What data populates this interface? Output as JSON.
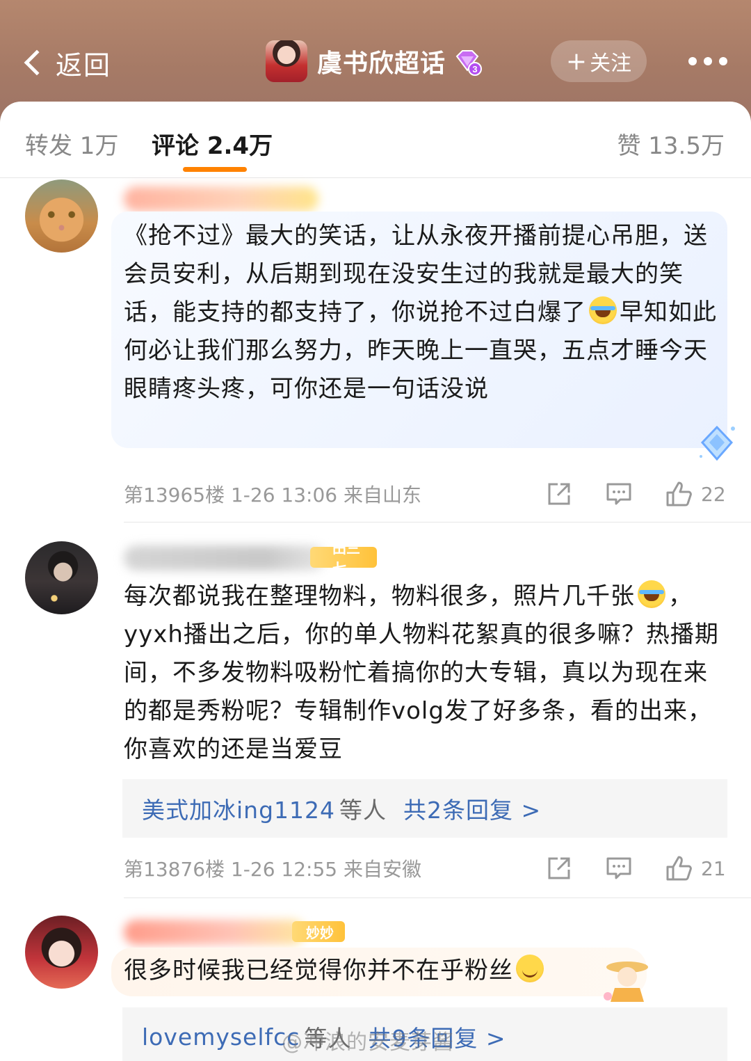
{
  "header": {
    "back_label": "返回",
    "topic_title": "虞书欣超话",
    "badge_level": "3",
    "follow_label": "关注"
  },
  "tabs": {
    "forward": "转发 1万",
    "comment": "评论 2.4万",
    "like": "赞 13.5万"
  },
  "comments": [
    {
      "vip_tag": "",
      "text_before": "《抢不过》最大的笑话，让从永夜开播前提心吊胆，送会员安利，从后期到现在没安生过的我就是最大的笑话，能支持的都支持了，你说抢不过白爆了",
      "text_after": "早知如此何必让我们那么努力，昨天晚上一直哭，五点才睡今天眼睛疼头疼，可你还是一句话没说",
      "meta": "第13965楼 1-26 13:06 来自山东",
      "likes": "22"
    },
    {
      "vip_tag": "田三七",
      "text_before": "每次都说我在整理物料，物料很多，照片几千张",
      "text_after": "，yyxh播出之后，你的单人物料花絮真的很多嘛？热播期间，不多发物料吸粉忙着搞你的大专辑，真以为现在来的都是秀粉呢？专辑制作volg发了好多条，看的出来，你喜欢的还是当爱豆",
      "reply_names": "美式加冰ing1124",
      "reply_mid": "等人",
      "reply_count": "共2条回复 >",
      "meta": "第13876楼 1-26 12:55 来自安徽",
      "likes": "21"
    },
    {
      "vip_tag": "妙妙",
      "text_before": "很多时候我已经觉得你并不在乎粉丝",
      "reply_names": "lovemyselfcc",
      "reply_mid": "等人",
      "reply_count": "共9条回复 >"
    }
  ],
  "watermark": "@冲浪的安麦芽酱",
  "colors": {
    "header_bg": "#a67a66",
    "accent": "#ff8200",
    "link": "#3d6bb5"
  }
}
